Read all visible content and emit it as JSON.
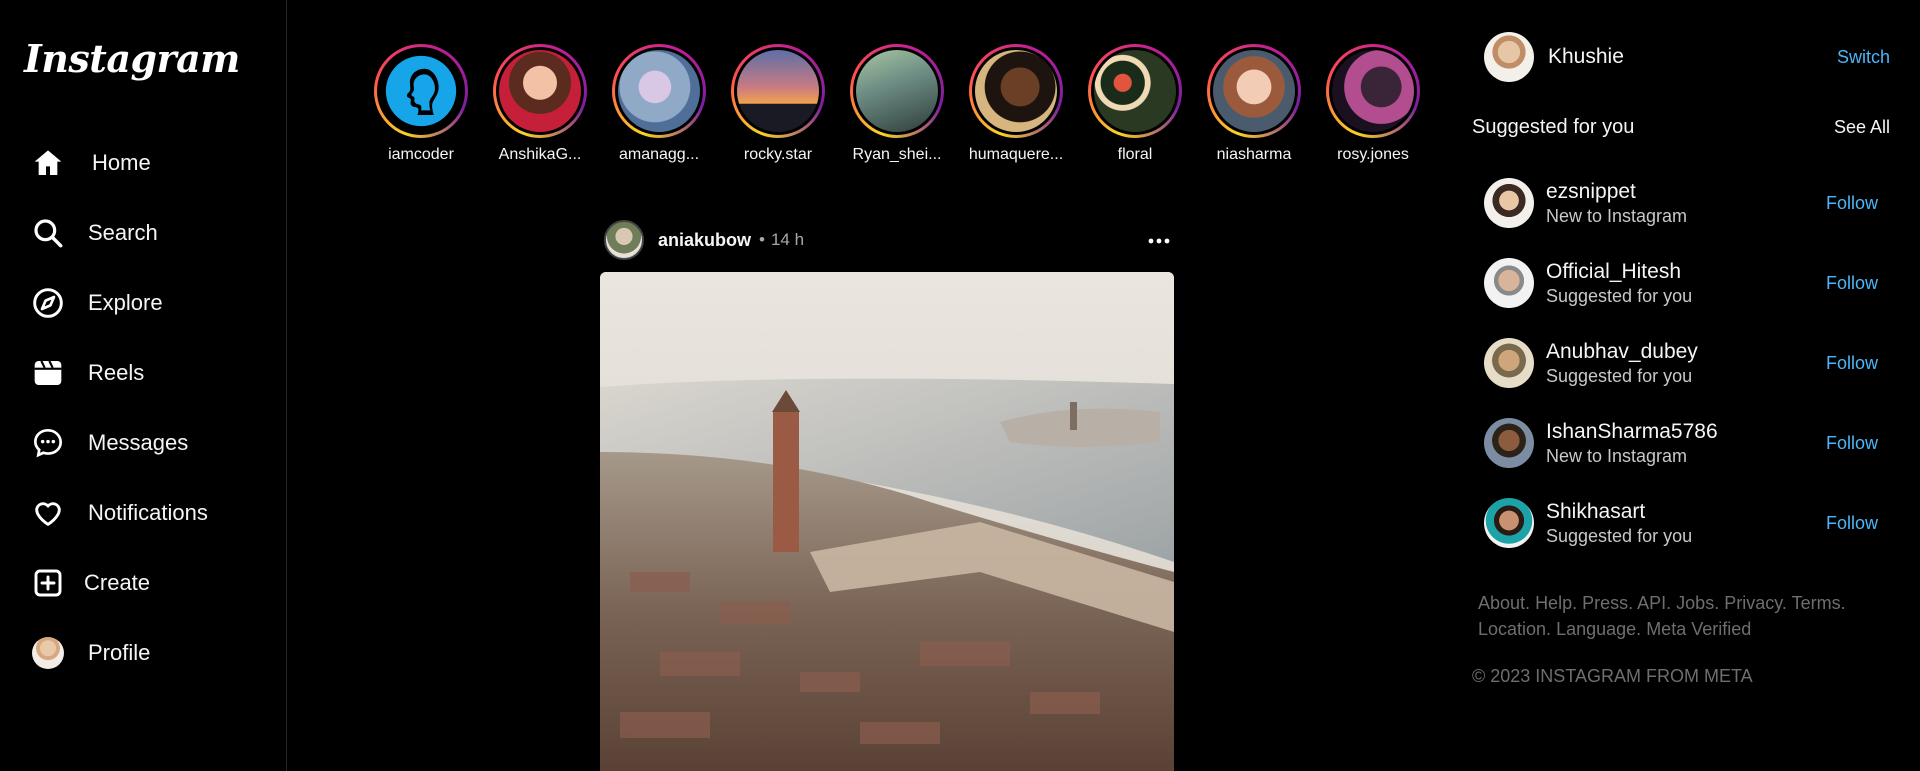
{
  "brand": {
    "logo": "Instagram"
  },
  "nav": [
    {
      "label": "Home",
      "icon": "home-icon"
    },
    {
      "label": "Search",
      "icon": "search-icon"
    },
    {
      "label": "Explore",
      "icon": "compass-icon"
    },
    {
      "label": "Reels",
      "icon": "reels-icon"
    },
    {
      "label": "Messages",
      "icon": "messages-icon"
    },
    {
      "label": "Notifications",
      "icon": "heart-icon"
    },
    {
      "label": "Create",
      "icon": "plus-square-icon"
    },
    {
      "label": "Profile",
      "icon": "avatar"
    }
  ],
  "stories": [
    {
      "name": "iamcoder"
    },
    {
      "name": "AnshikaG..."
    },
    {
      "name": "amanagg..."
    },
    {
      "name": "rocky.star"
    },
    {
      "name": "Ryan_shei..."
    },
    {
      "name": "humaquere..."
    },
    {
      "name": "floral"
    },
    {
      "name": "niasharma"
    },
    {
      "name": "rosy.jones"
    }
  ],
  "post": {
    "username": "aniakubow",
    "separator": "•",
    "time": "14 h"
  },
  "me": {
    "username": "Khushie",
    "switch_label": "Switch"
  },
  "suggestions": {
    "title": "Suggested for you",
    "see_all": "See All",
    "items": [
      {
        "name": "ezsnippet",
        "sub": "New to Instagram",
        "action": "Follow"
      },
      {
        "name": "Official_Hitesh",
        "sub": "Suggested for you",
        "action": "Follow"
      },
      {
        "name": "Anubhav_dubey",
        "sub": "Suggested for you",
        "action": "Follow"
      },
      {
        "name": "IshanSharma5786",
        "sub": "New to Instagram",
        "action": "Follow"
      },
      {
        "name": "Shikhasart",
        "sub": "Suggested for you",
        "action": "Follow"
      }
    ]
  },
  "footer": {
    "links": [
      "About.",
      "Help.",
      "Press.",
      "API.",
      "Jobs.",
      "Privacy.",
      "Terms.",
      "Location.",
      "Language.",
      "Meta Verified"
    ],
    "copyright": "© 2023 INSTAGRAM FROM META"
  },
  "colors": {
    "background": "#000000",
    "accent": "#4cb5f9",
    "muted": "#6e6e6e"
  }
}
